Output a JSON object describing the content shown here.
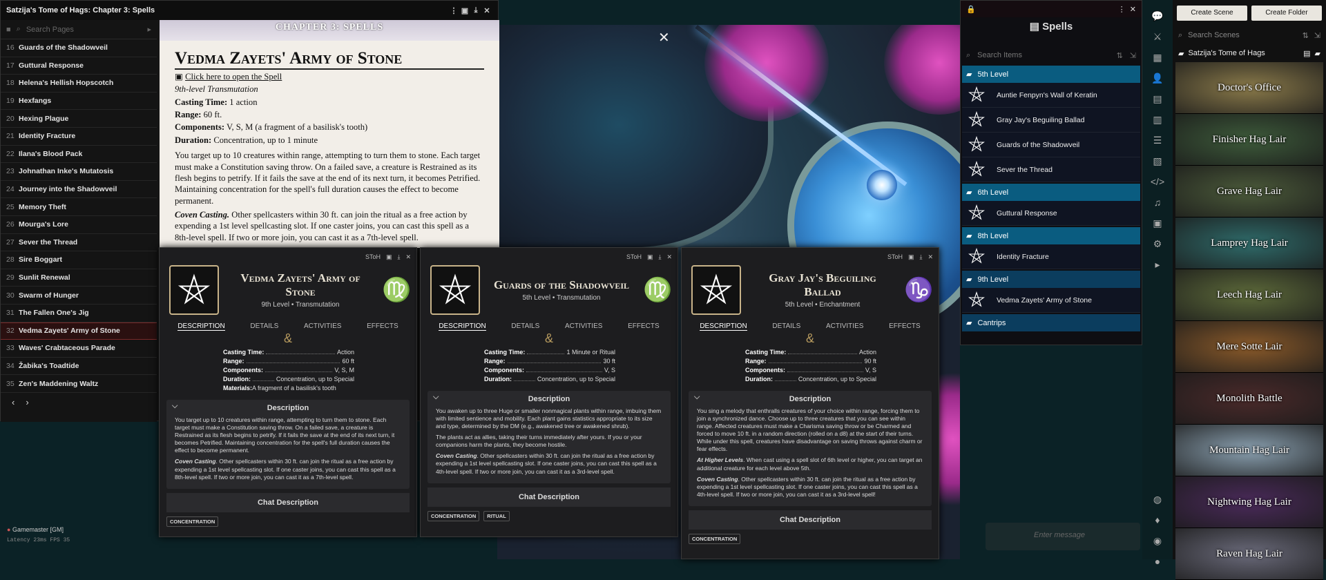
{
  "journal": {
    "title": "Satzija's Tome of Hags: Chapter 3: Spells",
    "search_placeholder": "Search Pages",
    "pages": [
      {
        "n": "16",
        "t": "Guards of the Shadowveil"
      },
      {
        "n": "17",
        "t": "Guttural Response"
      },
      {
        "n": "18",
        "t": "Helena's Hellish Hopscotch"
      },
      {
        "n": "19",
        "t": "Hexfangs"
      },
      {
        "n": "20",
        "t": "Hexing Plague"
      },
      {
        "n": "21",
        "t": "Identity Fracture"
      },
      {
        "n": "22",
        "t": "Ilana's Blood Pack"
      },
      {
        "n": "23",
        "t": "Johnathan Inke's Mutatosis"
      },
      {
        "n": "24",
        "t": "Journey into the Shadowveil"
      },
      {
        "n": "25",
        "t": "Memory Theft"
      },
      {
        "n": "26",
        "t": "Mourga's Lore"
      },
      {
        "n": "27",
        "t": "Sever the Thread"
      },
      {
        "n": "28",
        "t": "Sire Boggart"
      },
      {
        "n": "29",
        "t": "Sunlit Renewal"
      },
      {
        "n": "30",
        "t": "Swarm of Hunger"
      },
      {
        "n": "31",
        "t": "The Fallen One's Jig"
      },
      {
        "n": "32",
        "t": "Vedma Zayets' Army of Stone"
      },
      {
        "n": "33",
        "t": "Waves' Crabtaceous Parade"
      },
      {
        "n": "34",
        "t": "Žabika's Toadtide"
      },
      {
        "n": "35",
        "t": "Zen's Maddening Waltz"
      }
    ],
    "chapter_header": "CHAPTER 3: SPELLS",
    "heading": "Vedma Zayets' Army of Stone",
    "link": "Click here to open the Spell",
    "school": "9th-level Transmutation",
    "l1": "Casting Time:",
    "v1": " 1 action",
    "l2": "Range:",
    "v2": " 60 ft.",
    "l3": "Components:",
    "v3": " V, S, M (a fragment of a basilisk's tooth)",
    "l4": "Duration:",
    "v4": " Concentration, up to 1 minute",
    "p1": "You target up to 10 creatures within range, attempting to turn them to stone. Each target must make a Constitution saving throw. On a failed save, a creature is Restrained as its flesh begins to petrify. If it fails the save at the end of its next turn, it becomes Petrified. Maintaining concentration for the spell's full duration causes the effect to become permanent.",
    "p2b": "Coven Casting.",
    "p2": " Other spellcasters within 30 ft. can join the ritual as a free action by expending a 1st level spellcasting slot. If one caster joins, you can cast this spell as a 8th-level spell. If two or more join, you can cast it as a 7th-level spell."
  },
  "sheets": [
    {
      "tag": "SToH",
      "title": "Vedma Zayets' Army of Stone",
      "sub": "9th Level • Transmutation",
      "sym": "♍",
      "tabs": [
        "DESCRIPTION",
        "DETAILS",
        "ACTIVITIES",
        "EFFECTS"
      ],
      "props": [
        [
          "Casting Time:",
          "Action"
        ],
        [
          "Range:",
          "60 ft"
        ],
        [
          "Components:",
          "V, S, M"
        ],
        [
          "Duration:",
          "Concentration, up to Special"
        ]
      ],
      "materials_l": "Materials:",
      "materials": " A fragment of a basilisk's tooth",
      "desc_h": "Description",
      "d1": "You target up to 10 creatures within range, attempting to turn them to stone. Each target must make a Constitution saving throw. On a failed save, a creature is Restrained as its flesh begins to petrify. If it fails the save at the end of its next turn, it becomes Petrified. Maintaining concentration for the spell's full duration causes the effect to become permanent.",
      "d2b": "Coven Casting",
      "d2": ". Other spellcasters within 30 ft. can join the ritual as a free action by expending a 1st level spellcasting slot. If one caster joins, you can cast this spell as a 8th-level spell. If two or more join, you can cast it as a 7th-level spell.",
      "chat": "Chat Description",
      "tags": [
        "CONCENTRATION"
      ]
    },
    {
      "tag": "SToH",
      "title": "Guards of the Shadowveil",
      "sub": "5th Level • Transmutation",
      "sym": "♍",
      "tabs": [
        "DESCRIPTION",
        "DETAILS",
        "ACTIVITIES",
        "EFFECTS"
      ],
      "props": [
        [
          "Casting Time:",
          "1 Minute or Ritual"
        ],
        [
          "Range:",
          "30 ft"
        ],
        [
          "Components:",
          "V, S"
        ],
        [
          "Duration:",
          "Concentration, up to Special"
        ]
      ],
      "desc_h": "Description",
      "d1": "You awaken up to three Huge or smaller nonmagical plants within range, imbuing them with limited sentience and mobility. Each plant gains statistics appropriate to its size and type, determined by the DM (e.g., awakened tree or awakened shrub).",
      "d1b": "The plants act as allies, taking their turns immediately after yours. If you or your companions harm the plants, they become hostile.",
      "d2b": "Coven Casting",
      "d2": ". Other spellcasters within 30 ft. can join the ritual as a free action by expending a 1st level spellcasting slot. If one caster joins, you can cast this spell as a 4th-level spell. If two or more join, you can cast it as a 3rd-level spell.",
      "chat": "Chat Description",
      "tags": [
        "CONCENTRATION",
        "RITUAL"
      ]
    },
    {
      "tag": "SToH",
      "title": "Gray Jay's Beguiling Ballad",
      "sub": "5th Level • Enchantment",
      "sym": "♑",
      "tabs": [
        "DESCRIPTION",
        "DETAILS",
        "ACTIVITIES",
        "EFFECTS"
      ],
      "props": [
        [
          "Casting Time:",
          "Action"
        ],
        [
          "Range:",
          "90 ft"
        ],
        [
          "Components:",
          "V, S"
        ],
        [
          "Duration:",
          "Concentration, up to Special"
        ]
      ],
      "desc_h": "Description",
      "d1": "You sing a melody that enthralls creatures of your choice within range, forcing them to join a synchronized dance. Choose up to three creatures that you can see within range. Affected creatures must make a Charisma saving throw or be Charmed and forced to move 10 ft. in a random direction (rolled on a d8) at the start of their turns. While under this spell, creatures have disadvantage on saving throws against charm or fear effects.",
      "d1hb": "At Higher Levels",
      "d1h": ". When cast using a spell slot of 6th level or higher, you can target an additional creature for each level above 5th.",
      "d2b": "Coven Casting",
      "d2": ". Other spellcasters within 30 ft. can join the ritual as a free action by expending a 1st level spellcasting slot. If one caster joins, you can cast this spell as a 4th-level spell. If two or more join, you can cast it as a 3rd-level spell!",
      "chat": "Chat Description",
      "tags": [
        "CONCENTRATION"
      ]
    }
  ],
  "spells": {
    "title": "Spells",
    "search_placeholder": "Search Items",
    "groups": [
      {
        "label": "5th Level",
        "items": [
          "Auntie Fenpyn's Wall of Keratin",
          "Gray Jay's Beguiling Ballad",
          "Guards of the Shadowveil",
          "Sever the Thread"
        ]
      },
      {
        "label": "6th Level",
        "items": [
          "Guttural Response"
        ]
      },
      {
        "label": "8th Level",
        "items": [
          "Identity Fracture"
        ]
      },
      {
        "label": "9th Level",
        "items": [
          "Vedma Zayets' Army of Stone"
        ]
      }
    ],
    "cantrips": "Cantrips"
  },
  "scenes": {
    "create_scene": "Create Scene",
    "create_folder": "Create Folder",
    "search_placeholder": "Search Scenes",
    "folder": "Satzija's Tome of Hags",
    "items": [
      {
        "name": "Doctor's Office",
        "color": "#8a7a4a"
      },
      {
        "name": "Finisher Hag Lair",
        "color": "#3d5a3a"
      },
      {
        "name": "Grave Hag Lair",
        "color": "#4b5a3a"
      },
      {
        "name": "Lamprey Hag Lair",
        "color": "#2f6b6a"
      },
      {
        "name": "Leech Hag Lair",
        "color": "#5d6a3a"
      },
      {
        "name": "Mere Sotte Lair",
        "color": "#8a5a2a"
      },
      {
        "name": "Monolith Battle",
        "color": "#4a2a2a"
      },
      {
        "name": "Mountain Hag Lair",
        "color": "#8aa0b0"
      },
      {
        "name": "Nightwing Hag Lair",
        "color": "#4a2a5a"
      },
      {
        "name": "Raven Hag Lair",
        "color": "#6a6a7a"
      }
    ]
  },
  "chat": {
    "placeholder": "Enter message"
  },
  "players": {
    "gm": "Gamemaster [GM]",
    "latency": "Latency  23ms  FPS  35"
  }
}
